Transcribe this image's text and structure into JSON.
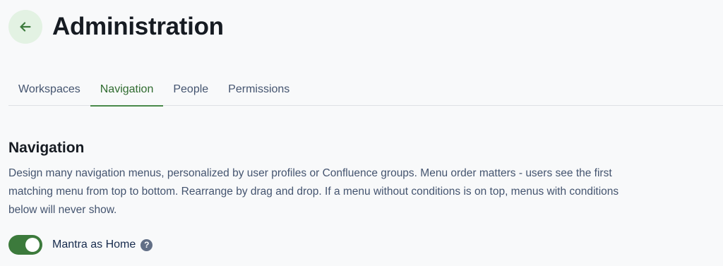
{
  "header": {
    "back_icon": "arrow-left-icon",
    "title": "Administration"
  },
  "tabs": [
    {
      "label": "Workspaces",
      "active": false
    },
    {
      "label": "Navigation",
      "active": true
    },
    {
      "label": "People",
      "active": false
    },
    {
      "label": "Permissions",
      "active": false
    }
  ],
  "section": {
    "title": "Navigation",
    "description": "Design many navigation menus, personalized by user profiles or Confluence groups. Menu order matters - users see the first matching menu from top to bottom. Rearrange by drag and drop. If a menu without conditions is on top, menus with conditions below will never show."
  },
  "setting": {
    "label": "Mantra as Home",
    "enabled": true,
    "help_icon": "question-circle-icon",
    "help_glyph": "?"
  },
  "colors": {
    "accent": "#3c7a3c",
    "back_button_bg": "#e3f2e3",
    "tab_active": "#2f6b2f"
  }
}
